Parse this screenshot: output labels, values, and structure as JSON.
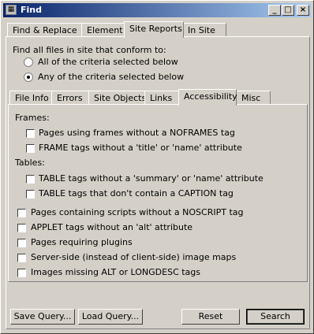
{
  "window": {
    "title": "Find",
    "minimize": "_",
    "maximize": "□",
    "close": "×"
  },
  "top_tabs": [
    "Find & Replace",
    "Element",
    "Site Reports",
    "In Site"
  ],
  "scope": {
    "heading": "Find all files in site that conform to:",
    "options": [
      "All of the criteria selected below",
      "Any of the criteria selected below"
    ],
    "selected": 1
  },
  "sub_tabs": [
    "File Info",
    "Errors",
    "Site Objects",
    "Links",
    "Accessibility",
    "Misc"
  ],
  "active_sub_tab": "Accessibility",
  "criteria": {
    "frames_label": "Frames:",
    "frames": [
      "Pages using frames without a NOFRAMES tag",
      "FRAME tags without a 'title' or 'name' attribute"
    ],
    "tables_label": "Tables:",
    "tables": [
      "TABLE tags without a 'summary' or 'name' attribute",
      "TABLE tags that don't contain a CAPTION tag"
    ],
    "other": [
      "Pages containing scripts without a NOSCRIPT tag",
      "APPLET tags without an 'alt' attribute",
      "Pages requiring plugins",
      "Server-side (instead of client-side) image maps",
      "Images missing ALT or LONGDESC tags"
    ]
  },
  "buttons": {
    "save_query": "Save Query...",
    "load_query": "Load Query...",
    "reset": "Reset",
    "search": "Search"
  }
}
